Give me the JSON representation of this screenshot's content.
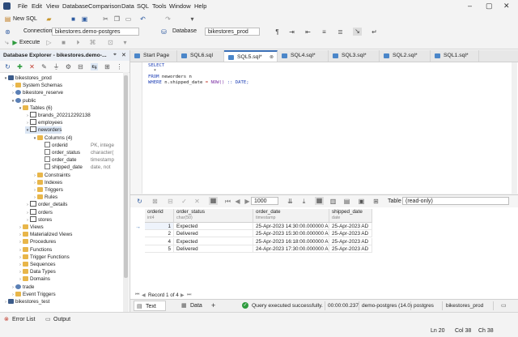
{
  "menubar": {
    "items": [
      "File",
      "Edit",
      "View",
      "Database",
      "Comparison",
      "Data",
      "SQL",
      "Tools",
      "Window",
      "Help"
    ]
  },
  "toolbar1": {
    "new_sql": "New SQL"
  },
  "toolbar2": {
    "connection_label": "Connection",
    "connection_value": "bikestores.demo-postgres",
    "database_label": "Database",
    "database_value": "bikestores_prod"
  },
  "toolbar3": {
    "execute": "Execute"
  },
  "explorer": {
    "title": "Database Explorer - bikestores.demo-...",
    "tree": [
      {
        "label": "bikestores_prod",
        "meta": "",
        "icon": "db",
        "indent": 0,
        "twisty": "▾"
      },
      {
        "label": "System Schemas",
        "meta": "",
        "icon": "folder",
        "indent": 1,
        "twisty": "›"
      },
      {
        "label": "bikestore_reserve",
        "meta": "",
        "icon": "schema",
        "indent": 1,
        "twisty": "›"
      },
      {
        "label": "public",
        "meta": "",
        "icon": "schema",
        "indent": 1,
        "twisty": "▾"
      },
      {
        "label": "Tables (6)",
        "meta": "",
        "icon": "folder",
        "indent": 2,
        "twisty": "▾"
      },
      {
        "label": "brands_202212292138",
        "meta": "",
        "icon": "table",
        "indent": 3,
        "twisty": "›"
      },
      {
        "label": "employees",
        "meta": "",
        "icon": "table",
        "indent": 3,
        "twisty": "›"
      },
      {
        "label": "neworders",
        "meta": "",
        "icon": "table",
        "indent": 3,
        "twisty": "▾",
        "selected": true
      },
      {
        "label": "Columns (4)",
        "meta": "",
        "icon": "folder",
        "indent": 4,
        "twisty": "▾"
      },
      {
        "label": "orderid",
        "meta": "PK, intege",
        "icon": "col",
        "indent": 5,
        "twisty": ""
      },
      {
        "label": "order_status",
        "meta": "character(",
        "icon": "col",
        "indent": 5,
        "twisty": ""
      },
      {
        "label": "order_date",
        "meta": "timestamp",
        "icon": "col",
        "indent": 5,
        "twisty": ""
      },
      {
        "label": "shipped_date",
        "meta": "date, not ",
        "icon": "col",
        "indent": 5,
        "twisty": ""
      },
      {
        "label": "Constraints",
        "meta": "",
        "icon": "folder",
        "indent": 4,
        "twisty": "›"
      },
      {
        "label": "Indexes",
        "meta": "",
        "icon": "folder",
        "indent": 4,
        "twisty": "›"
      },
      {
        "label": "Triggers",
        "meta": "",
        "icon": "folder",
        "indent": 4,
        "twisty": "›"
      },
      {
        "label": "Rules",
        "meta": "",
        "icon": "folder",
        "indent": 4,
        "twisty": "›"
      },
      {
        "label": "order_details",
        "meta": "",
        "icon": "table",
        "indent": 3,
        "twisty": "›"
      },
      {
        "label": "orders",
        "meta": "",
        "icon": "table",
        "indent": 3,
        "twisty": "›"
      },
      {
        "label": "stores",
        "meta": "",
        "icon": "table",
        "indent": 3,
        "twisty": "›"
      },
      {
        "label": "Views",
        "meta": "",
        "icon": "folder",
        "indent": 2,
        "twisty": "›"
      },
      {
        "label": "Materialized Views",
        "meta": "",
        "icon": "folder",
        "indent": 2,
        "twisty": "›"
      },
      {
        "label": "Procedures",
        "meta": "",
        "icon": "folder",
        "indent": 2,
        "twisty": "›"
      },
      {
        "label": "Functions",
        "meta": "",
        "icon": "folder",
        "indent": 2,
        "twisty": "›"
      },
      {
        "label": "Trigger Functions",
        "meta": "",
        "icon": "folder",
        "indent": 2,
        "twisty": "›"
      },
      {
        "label": "Sequences",
        "meta": "",
        "icon": "folder",
        "indent": 2,
        "twisty": "›"
      },
      {
        "label": "Data Types",
        "meta": "",
        "icon": "folder",
        "indent": 2,
        "twisty": "›"
      },
      {
        "label": "Domains",
        "meta": "",
        "icon": "folder",
        "indent": 2,
        "twisty": "›"
      },
      {
        "label": "trade",
        "meta": "",
        "icon": "schema",
        "indent": 1,
        "twisty": "›"
      },
      {
        "label": "Event Triggers",
        "meta": "",
        "icon": "folder",
        "indent": 1,
        "twisty": "›"
      },
      {
        "label": "bikestores_test",
        "meta": "",
        "icon": "db",
        "indent": 0,
        "twisty": "›"
      }
    ]
  },
  "tabs": [
    {
      "label": "Start Page",
      "active": false
    },
    {
      "label": "SQL6.sql",
      "active": false
    },
    {
      "label": "SQL5.sql*",
      "active": true
    },
    {
      "label": "SQL4.sql*",
      "active": false
    },
    {
      "label": "SQL3.sql*",
      "active": false
    },
    {
      "label": "SQL2.sql*",
      "active": false
    },
    {
      "label": "SQL1.sql*",
      "active": false
    }
  ],
  "editor": {
    "line1": "SELECT",
    "line2": "  *",
    "line3_kw": "FROM",
    "line3_rest": " neworders n",
    "line4_kw": "WHERE",
    "line4_a": " n.shipped_date ",
    "line4_op": "= ",
    "line4_fn": "NOW()",
    "line4_b": " :: DATE;"
  },
  "results_toolbar": {
    "limit": "1000",
    "view_label": "Table",
    "readonly": "(read-only)"
  },
  "grid": {
    "columns": [
      {
        "name": "orderid",
        "type": "int4"
      },
      {
        "name": "order_status",
        "type": "char(50)"
      },
      {
        "name": "order_date",
        "type": "timestamp"
      },
      {
        "name": "shipped_date",
        "type": "date"
      }
    ],
    "rows": [
      [
        "1",
        "Expected",
        "25-Apr-2023 14:30:00.000000 AD",
        "25-Apr-2023 AD"
      ],
      [
        "2",
        "Delivered",
        "25-Apr-2023 15:30:00.000000 AD",
        "25-Apr-2023 AD"
      ],
      [
        "4",
        "Expected",
        "25-Apr-2023 16:18:00.000000 AD",
        "25-Apr-2023 AD"
      ],
      [
        "5",
        "Delivered",
        "24-Apr-2023 17:30:00.000000 AD",
        "25-Apr-2023 AD"
      ]
    ]
  },
  "record_status": "Record 1 of 4",
  "result_tabs": {
    "text": "Text",
    "data": "Data",
    "add": "+"
  },
  "exec_status": {
    "message": "Query executed successfully.",
    "time": "00:00:00.237",
    "connection": "demo-postgres (14.0)",
    "user": "postgres",
    "db": "bikestores_prod"
  },
  "bottom": {
    "error_list": "Error List",
    "output": "Output"
  },
  "statusbar": {
    "ln": "Ln 20",
    "col": "Col 38",
    "ch": "Ch 38"
  },
  "colors": {
    "accent": "#3a6fb6",
    "keyword": "#1e3fb5",
    "success": "#2e9b3e"
  }
}
